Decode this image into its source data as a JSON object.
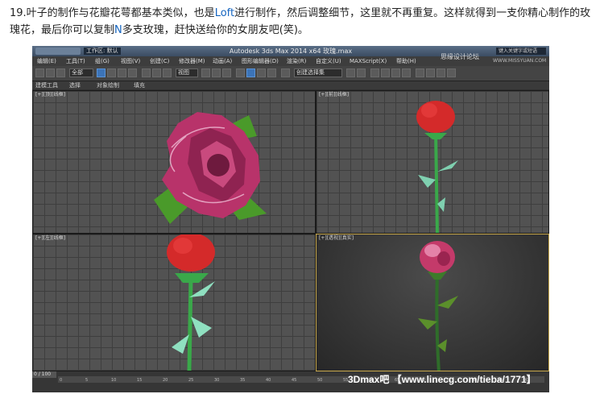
{
  "caption": {
    "part1": "19.叶子的制作与花瓣花萼都基本类似，也是",
    "loft": "Loft",
    "part2": "进行制作，然后调整细节，这里就不再重复。这样就得到一支你精心制作的玫瑰花，最后你可以复制",
    "n": "N",
    "part3": "多支玫瑰，赶快送给你的女朋友吧(笑)。"
  },
  "app": {
    "title": "Autodesk 3ds Max  2014 x64      玫瑰.max",
    "workspace": "工作区: 默认",
    "search_placeholder": "键入关键字或短语",
    "menu": [
      "编辑(E)",
      "工具(T)",
      "组(G)",
      "视图(V)",
      "创建(C)",
      "修改器(M)",
      "动画(A)",
      "图形编辑器(D)",
      "渲染(R)",
      "自定义(U)",
      "MAXScript(X)",
      "帮助(H)"
    ],
    "selection_filter": "全部",
    "ref_coord": "视图",
    "selection_set": "创建选择集",
    "ribbon_tabs": [
      "建模工具",
      "选择",
      "对象绘制",
      "填充"
    ],
    "viewports": {
      "top_left": "[+][顶][线框]",
      "top_right": "[+][前][线框]",
      "bottom_left": "[+][左][线框]",
      "bottom_right": "[+][透视][真实]"
    },
    "frame_counter": "0 / 100",
    "timeline_ticks": [
      "0",
      "5",
      "10",
      "15",
      "20",
      "25",
      "30",
      "35",
      "40",
      "45",
      "50",
      "55",
      "60",
      "65",
      "70",
      "75",
      "80",
      "85",
      "90"
    ]
  },
  "watermarks": {
    "forum": "思缘设计论坛",
    "site": "WWW.MISSYUAN.COM",
    "bottom": "3Dmax吧 【www.linecg.com/tieba/1771】"
  },
  "colors": {
    "rose_red": "#d42a2a",
    "petal_pink": "#b8336a",
    "stem_green": "#3aa84a",
    "accent_blue": "#1565c0"
  }
}
